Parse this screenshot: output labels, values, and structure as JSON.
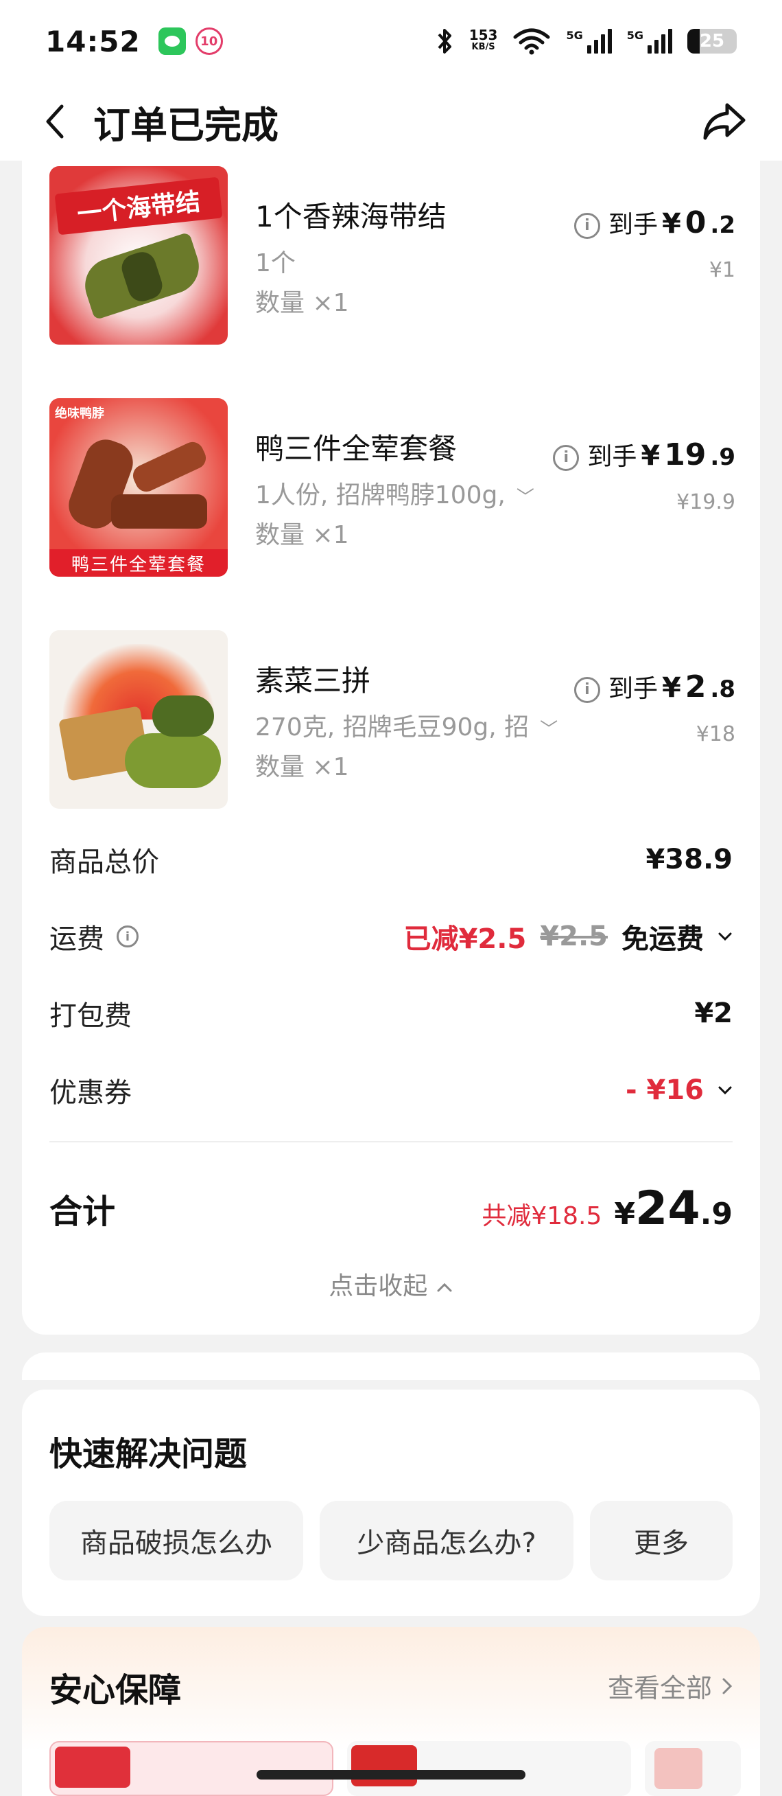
{
  "status_bar": {
    "time": "14:52",
    "speed_value": "153",
    "speed_unit": "KB/S",
    "network1": "5G",
    "network2": "5G",
    "battery": "25",
    "icons": [
      "wechat-icon",
      "app-notification-icon",
      "bluetooth-icon",
      "wifi-icon",
      "signal-icon",
      "battery-icon"
    ]
  },
  "header": {
    "title": "订单已完成",
    "back_icon": "chevron-left-icon",
    "share_icon": "share-icon"
  },
  "products": [
    {
      "name": "1个香辣海带结",
      "spec": "1个",
      "qty": "数量 ×1",
      "price_label": "到手",
      "price_currency": "¥",
      "price_int": "0",
      "price_dec": ".2",
      "original_price": "¥1",
      "thumb_text": "一个海带结"
    },
    {
      "name": "鸭三件全荤套餐",
      "spec": "1人份, 招牌鸭脖100g,",
      "qty": "数量 ×1",
      "price_label": "到手",
      "price_currency": "¥",
      "price_int": "19",
      "price_dec": ".9",
      "original_price": "¥19.9",
      "thumb_text": "鸭三件全荤套餐",
      "thumb_brand": "绝味鸭脖"
    },
    {
      "name": "素菜三拼",
      "spec": "270克, 招牌毛豆90g, 招",
      "qty": "数量 ×1",
      "price_label": "到手",
      "price_currency": "¥",
      "price_int": "2",
      "price_dec": ".8",
      "original_price": "¥18"
    }
  ],
  "fees": {
    "subtotal_label": "商品总价",
    "subtotal_value": "¥38.9",
    "delivery_label": "运费",
    "delivery_reduced": "已减¥2.5",
    "delivery_original": "¥2.5",
    "delivery_value": "免运费",
    "packing_label": "打包费",
    "packing_value": "¥2",
    "coupon_label": "优惠券",
    "coupon_value": "- ¥16"
  },
  "total": {
    "label": "合计",
    "saved": "共减¥18.5",
    "currency": "¥",
    "int": "24",
    "dec": ".9"
  },
  "collapse_label": "点击收起",
  "quick_solve": {
    "title": "快速解决问题",
    "buttons": [
      "商品破损怎么办",
      "少商品怎么办?",
      "更多"
    ]
  },
  "assurance": {
    "title": "安心保障",
    "link": "查看全部"
  },
  "colors": {
    "accent_red": "#e02b3c",
    "text_gray": "#999999",
    "card_bg": "#ffffff",
    "page_bg": "#f2f2f2"
  }
}
